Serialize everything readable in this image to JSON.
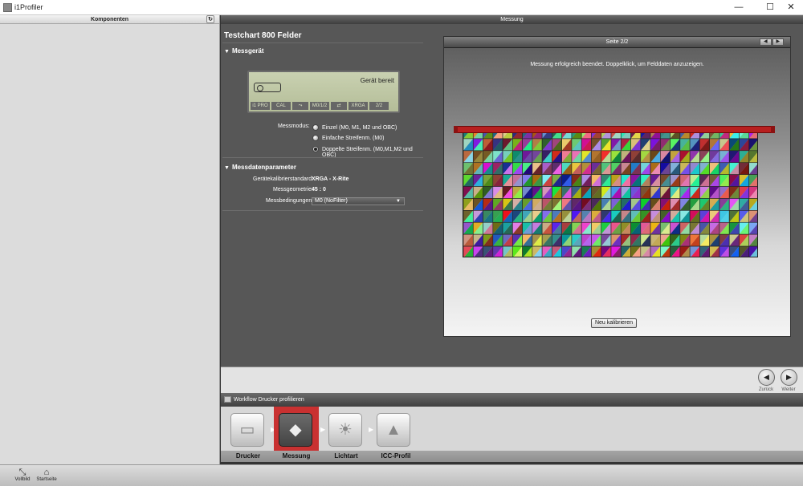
{
  "window": {
    "title": "i1Profiler",
    "minimize": "—",
    "maximize": "☐",
    "close": "✕"
  },
  "left_panel": {
    "header": "Komponenten",
    "refresh_icon": "↻"
  },
  "center": {
    "header": "Messung",
    "page_title": "Testchart 800 Felder",
    "section_device": "Messgerät",
    "device": {
      "status": "Gerät bereit",
      "segments": [
        "i1 PRO",
        "CAL",
        "⤳",
        "M0/1/2",
        "⇄",
        "XRGA",
        "2/2"
      ]
    },
    "mode_label": "Messmodus:",
    "modes": [
      {
        "label": "Einzel (M0, M1, M2 und OBC)",
        "checked": false
      },
      {
        "label": "Einfache Streifenm. (M0)",
        "checked": false
      },
      {
        "label": "Doppelte Streifenm. (M0,M1,M2 und OBC)",
        "checked": true
      }
    ],
    "section_params": "Messdatenparameter",
    "params": {
      "calib_label": "Gerätekalibrierstandard:",
      "calib_value": "XRGA - X-Rite",
      "geometry_label": "Messgeometrie:",
      "geometry_value": "45 : 0",
      "conditions_label": "Messbedingungen:",
      "conditions_value": "M0 (NoFilter)"
    }
  },
  "measurement": {
    "page_label": "Seite 2/2",
    "pager_prev": "◀",
    "pager_next": "▶",
    "message": "Messung erfolgreich beendet. Doppelklick, um Felddaten anzuzeigen.",
    "recalibrate_button": "Neu kalibrieren",
    "grid_rows": 11,
    "grid_cols": 30
  },
  "navigation": {
    "back_label": "Zurück",
    "next_label": "Weiter",
    "back_icon": "◀",
    "next_icon": "▶"
  },
  "workflow": {
    "title": "Workflow Drucker profilieren",
    "steps": [
      {
        "label": "Drucker",
        "icon": "printer-icon",
        "glyph": "▭",
        "active": false
      },
      {
        "label": "Messung",
        "icon": "measure-icon",
        "glyph": "◆",
        "active": true
      },
      {
        "label": "Lichtart",
        "icon": "lightbulb-icon",
        "glyph": "☀",
        "active": false
      },
      {
        "label": "ICC-Profil",
        "icon": "icc-profile-icon",
        "glyph": "▲",
        "active": false
      }
    ]
  },
  "bottom": {
    "fullscreen_label": "Vollbild",
    "home_label": "Startseite",
    "fullscreen_icon": "⤡",
    "home_icon": "⌂"
  },
  "colors": {
    "accent_red": "#c93131",
    "dark_bg": "#575757"
  }
}
